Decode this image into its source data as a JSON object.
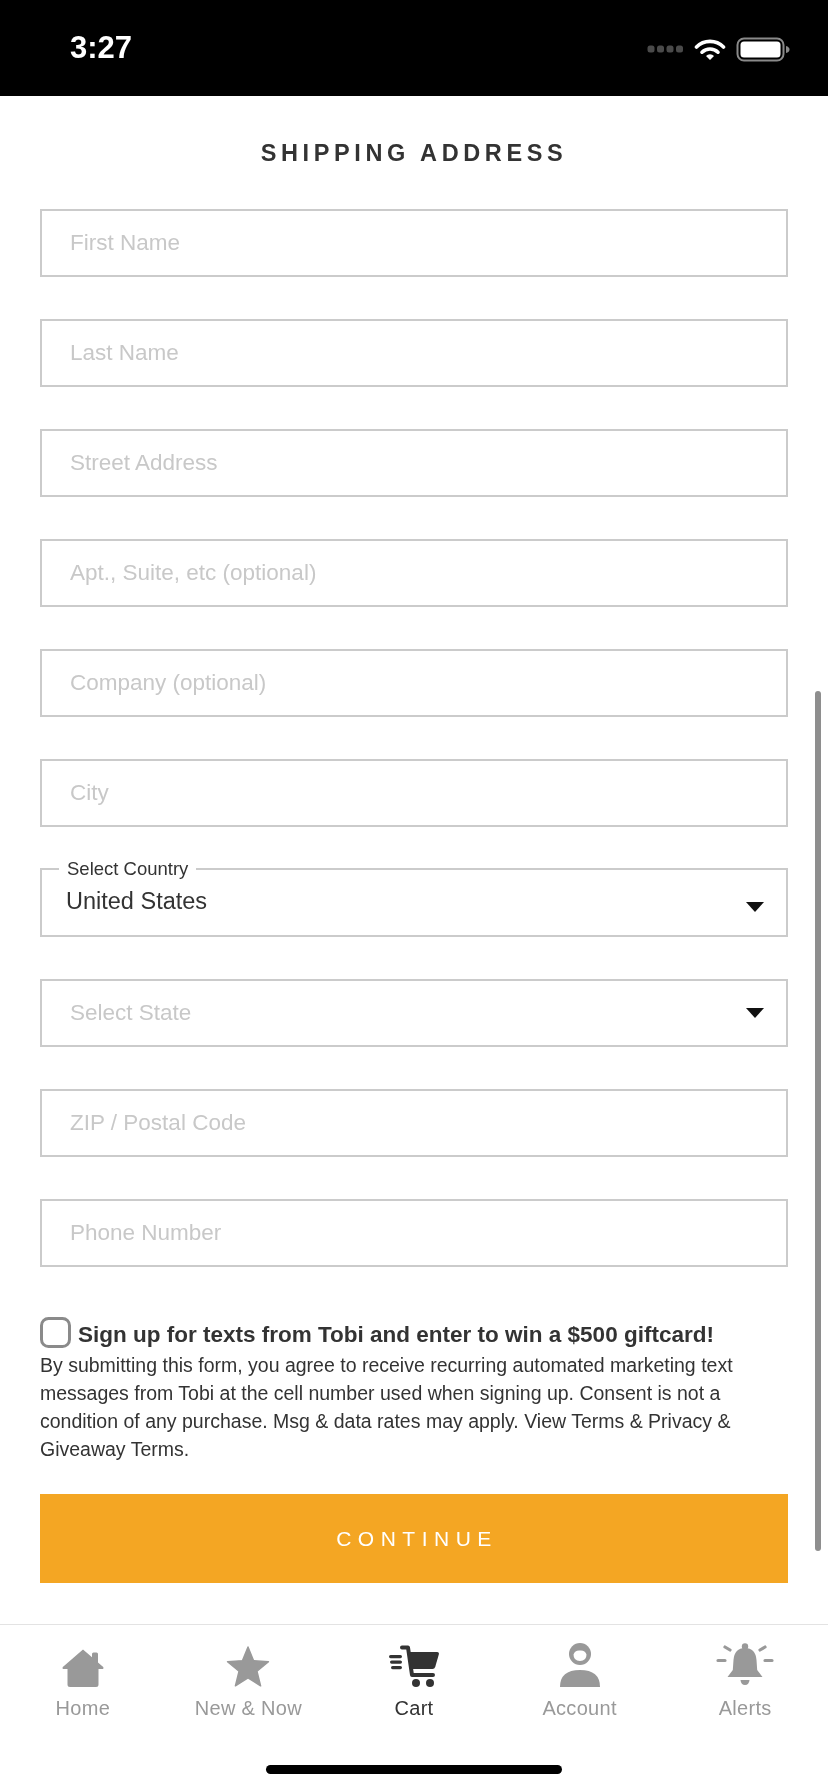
{
  "status_bar": {
    "time": "3:27"
  },
  "header": {
    "title": "SHIPPING ADDRESS"
  },
  "form": {
    "fields": [
      {
        "kind": "text",
        "placeholder": "First Name"
      },
      {
        "kind": "text",
        "placeholder": "Last Name"
      },
      {
        "kind": "text",
        "placeholder": "Street Address"
      },
      {
        "kind": "text",
        "placeholder": "Apt., Suite, etc (optional)"
      },
      {
        "kind": "text",
        "placeholder": "Company (optional)"
      },
      {
        "kind": "text",
        "placeholder": "City"
      },
      {
        "kind": "select",
        "label": "Select Country",
        "value": "United States"
      },
      {
        "kind": "select",
        "placeholder": "Select State"
      },
      {
        "kind": "text",
        "placeholder": "ZIP / Postal Code"
      },
      {
        "kind": "text",
        "placeholder": "Phone Number"
      }
    ]
  },
  "sms_optin": {
    "checked": false,
    "label": "Sign up for texts from Tobi and enter to win a $500 giftcard!",
    "disclaimer": "By submitting this form, you agree to receive recurring automated marketing text messages from Tobi at the cell number used when signing up. Consent is not a condition of any purchase. Msg & data rates may apply. View Terms & Privacy & Giveaway Terms."
  },
  "continue_button": {
    "label": "CONTINUE"
  },
  "tab_bar": {
    "items": [
      {
        "label": "Home",
        "selected": false
      },
      {
        "label": "New & Now",
        "selected": false
      },
      {
        "label": "Cart",
        "selected": true
      },
      {
        "label": "Account",
        "selected": false
      },
      {
        "label": "Alerts",
        "selected": false
      }
    ]
  }
}
